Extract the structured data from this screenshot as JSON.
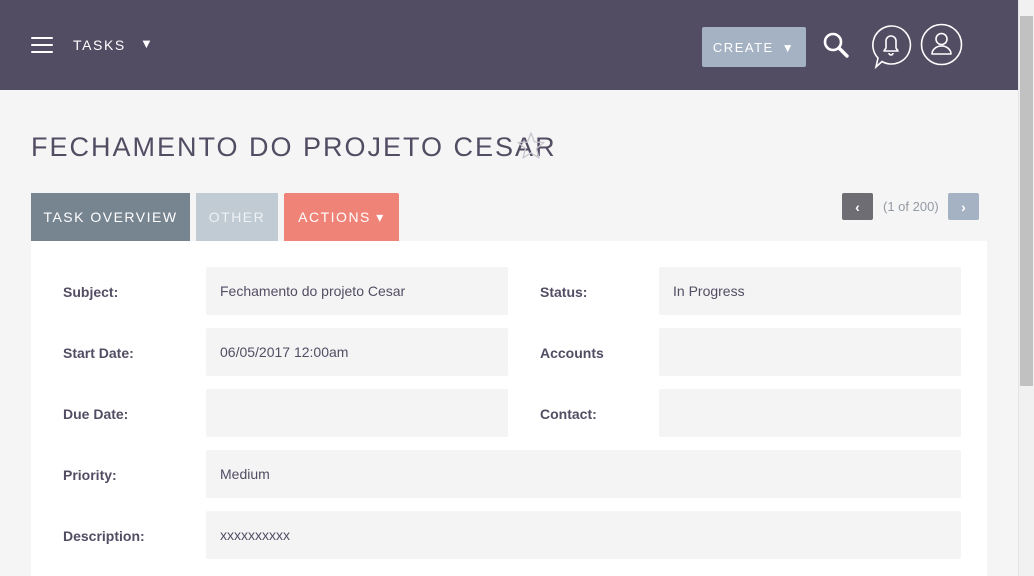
{
  "nav": {
    "module": "TASKS",
    "module_caret": "▼",
    "create_label": "CREATE",
    "create_caret": "▼",
    "icons": [
      "menu-icon",
      "search-icon",
      "bell-icon",
      "user-icon"
    ],
    "bar_color": "#534d64"
  },
  "record": {
    "title": "FECHAMENTO DO PROJETO CESAR"
  },
  "tabs": [
    {
      "label": "TASK OVERVIEW",
      "active": true
    },
    {
      "label": "OTHER",
      "active": false
    },
    {
      "label": "ACTIONS ▾",
      "active": false
    }
  ],
  "pagination": {
    "prev": "‹",
    "text": "(1 of 200)",
    "next": "›"
  },
  "fields": {
    "subject": {
      "label": "Subject:",
      "value": "Fechamento do projeto Cesar"
    },
    "status": {
      "label": "Status:",
      "value": "In Progress"
    },
    "start_date": {
      "label": "Start Date:",
      "value": "06/05/2017 12:00am"
    },
    "accounts": {
      "label": "Accounts",
      "value": ""
    },
    "due_date": {
      "label": "Due Date:",
      "value": ""
    },
    "contact": {
      "label": "Contact:",
      "value": ""
    },
    "priority": {
      "label": "Priority:",
      "value": "Medium"
    },
    "description": {
      "label": "Description:",
      "value": "xxxxxxxxxx"
    }
  },
  "colors": {
    "tab_overview": "#778591",
    "tab_other": "#c0cbd4",
    "tab_actions": "#f08377",
    "create_button": "#a5b2c3"
  }
}
